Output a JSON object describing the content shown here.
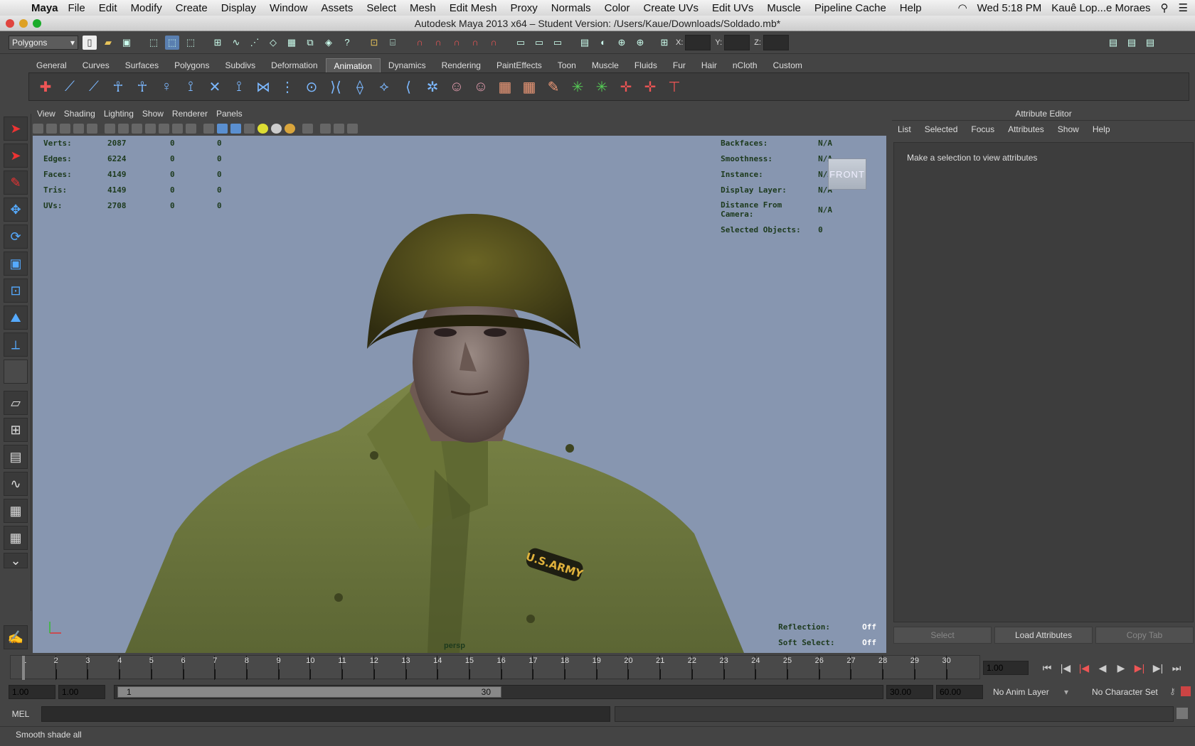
{
  "os_menubar": {
    "app_name": "Maya",
    "items": [
      "File",
      "Edit",
      "Modify",
      "Create",
      "Display",
      "Window",
      "Assets",
      "Select",
      "Mesh",
      "Edit Mesh",
      "Proxy",
      "Normals",
      "Color",
      "Create UVs",
      "Edit UVs",
      "Muscle",
      "Pipeline Cache",
      "Help"
    ],
    "clock": "Wed 5:18 PM",
    "user": "Kauê Lop...e Moraes"
  },
  "window": {
    "title": "Autodesk Maya 2013 x64 – Student Version: /Users/Kaue/Downloads/Soldado.mb*"
  },
  "status_line": {
    "mode": "Polygons",
    "coord_labels": [
      "X:",
      "Y:",
      "Z:"
    ]
  },
  "shelf": {
    "tabs": [
      "General",
      "Curves",
      "Surfaces",
      "Polygons",
      "Subdivs",
      "Deformation",
      "Animation",
      "Dynamics",
      "Rendering",
      "PaintEffects",
      "Toon",
      "Muscle",
      "Fluids",
      "Fur",
      "Hair",
      "nCloth",
      "Custom"
    ],
    "active_tab": "Animation"
  },
  "viewport": {
    "menu": [
      "View",
      "Shading",
      "Lighting",
      "Show",
      "Renderer",
      "Panels"
    ],
    "stats_left": [
      {
        "label": "Verts:",
        "v1": "2087",
        "v2": "0",
        "v3": "0"
      },
      {
        "label": "Edges:",
        "v1": "6224",
        "v2": "0",
        "v3": "0"
      },
      {
        "label": "Faces:",
        "v1": "4149",
        "v2": "0",
        "v3": "0"
      },
      {
        "label": "Tris:",
        "v1": "4149",
        "v2": "0",
        "v3": "0"
      },
      {
        "label": "UVs:",
        "v1": "2708",
        "v2": "0",
        "v3": "0"
      }
    ],
    "stats_right": [
      {
        "label": "Backfaces:",
        "value": "N/A"
      },
      {
        "label": "Smoothness:",
        "value": "N/A"
      },
      {
        "label": "Instance:",
        "value": "N/A"
      },
      {
        "label": "Display Layer:",
        "value": "N/A"
      },
      {
        "label": "Distance From Camera:",
        "value": "N/A"
      },
      {
        "label": "Selected Objects:",
        "value": "0"
      }
    ],
    "view_cube": "FRONT",
    "bottom_right": [
      {
        "label": "Reflection:",
        "value": "Off"
      },
      {
        "label": "Soft Select:",
        "value": "Off"
      }
    ],
    "camera_name": "persp",
    "patch_text": "U.S.ARMY"
  },
  "attribute_editor": {
    "title": "Attribute Editor",
    "menu": [
      "List",
      "Selected",
      "Focus",
      "Attributes",
      "Show",
      "Help"
    ],
    "message": "Make a selection to view attributes",
    "buttons": [
      "Select",
      "Load Attributes",
      "Copy Tab"
    ]
  },
  "timeline": {
    "ticks": [
      "1",
      "2",
      "3",
      "4",
      "5",
      "6",
      "7",
      "8",
      "9",
      "10",
      "11",
      "12",
      "13",
      "14",
      "15",
      "16",
      "17",
      "18",
      "19",
      "20",
      "21",
      "22",
      "23",
      "24",
      "25",
      "26",
      "27",
      "28",
      "29",
      "30"
    ],
    "current_frame": "1.00"
  },
  "range_slider": {
    "start": "1.00",
    "playback_start": "1.00",
    "slider_start": "1",
    "slider_end": "30",
    "playback_end": "30.00",
    "end": "60.00",
    "anim_layer": "No Anim Layer",
    "character_set": "No Character Set"
  },
  "command_line": {
    "label": "MEL"
  },
  "help_line": {
    "text": "Smooth shade all"
  },
  "colors": {
    "viewport_bg": "#8796b0",
    "hud_text": "#1d3a1d",
    "ui_bg": "#444444"
  }
}
